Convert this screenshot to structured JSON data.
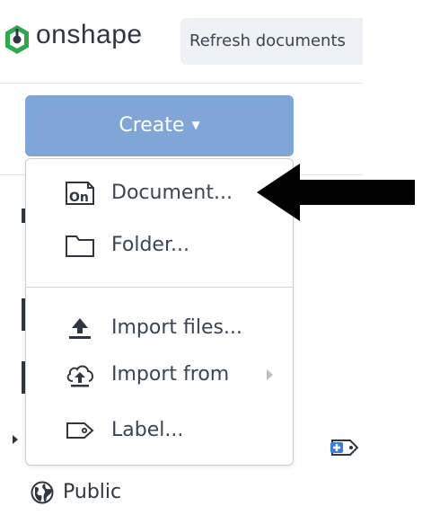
{
  "app": {
    "logo_text": "onshape",
    "refresh_label": "Refresh documents"
  },
  "create_button": {
    "label": "Create"
  },
  "menu": {
    "items": [
      {
        "label": "Document...",
        "icon": "onshape-document-icon"
      },
      {
        "label": "Folder...",
        "icon": "folder-icon"
      },
      {
        "label": "Import files...",
        "icon": "upload-icon"
      },
      {
        "label": "Import from",
        "icon": "cloud-upload-icon",
        "has_submenu": true
      },
      {
        "label": "Label...",
        "icon": "tag-icon"
      }
    ]
  },
  "sidebar": {
    "public_label": "Public"
  },
  "colors": {
    "accent": "#7fa6d6",
    "text": "#3a4552",
    "annotation_arrow": "#000000"
  }
}
